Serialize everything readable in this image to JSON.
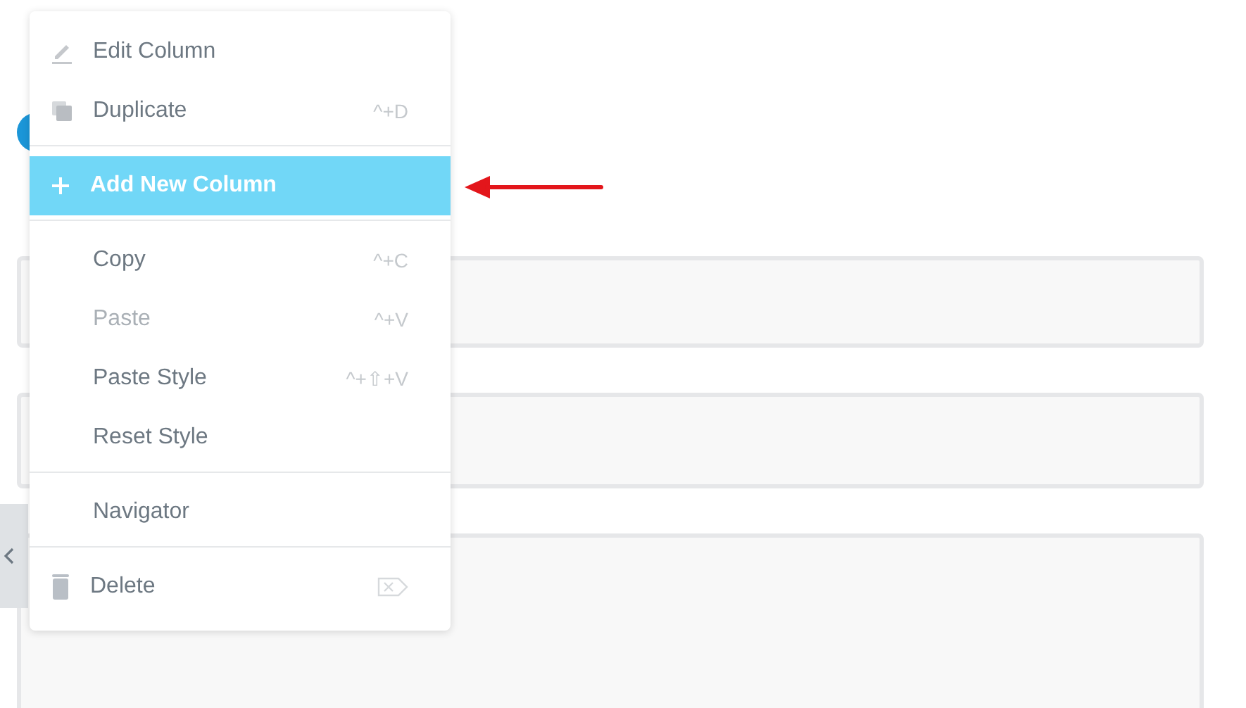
{
  "menu": {
    "groups": [
      {
        "items": [
          {
            "kind": "pencil",
            "label": "Edit Column",
            "selected": false,
            "disabled": false
          },
          {
            "kind": "copy",
            "label": "Duplicate",
            "shortcut": "^+D",
            "selected": false,
            "disabled": false
          }
        ]
      },
      {
        "items": [
          {
            "kind": "plus",
            "label": "Add New Column",
            "selected": true,
            "disabled": false
          }
        ]
      },
      {
        "items": [
          {
            "kind": "plain",
            "label": "Copy",
            "shortcut": "^+C",
            "selected": false,
            "disabled": false
          },
          {
            "kind": "plain",
            "label": "Paste",
            "shortcut": "^+V",
            "selected": false,
            "disabled": true
          },
          {
            "kind": "plain",
            "label": "Paste Style",
            "shortcut": "^+⇧+V",
            "selected": false,
            "disabled": false
          },
          {
            "kind": "plain",
            "label": "Reset Style",
            "selected": false,
            "disabled": false
          }
        ]
      },
      {
        "items": [
          {
            "kind": "plain",
            "label": "Navigator",
            "selected": false,
            "disabled": false
          }
        ]
      },
      {
        "items": [
          {
            "kind": "trash",
            "label": "Delete",
            "selected": false,
            "disabled": false
          }
        ]
      }
    ]
  }
}
